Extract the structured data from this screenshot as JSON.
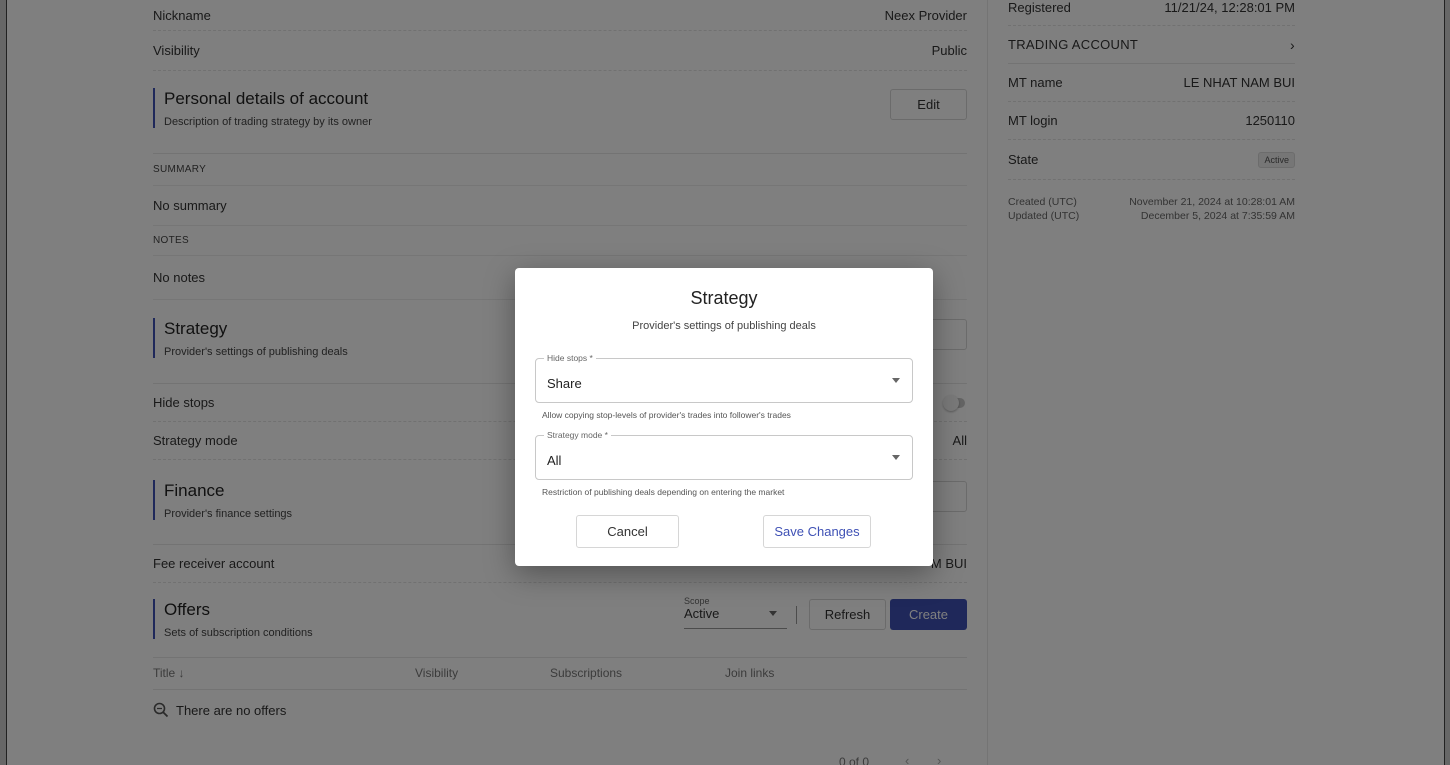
{
  "account": {
    "nickname_label": "Nickname",
    "nickname_value": "Neex Provider",
    "visibility_label": "Visibility",
    "visibility_value": "Public"
  },
  "personal": {
    "title": "Personal details of account",
    "subtitle": "Description of trading strategy by its owner",
    "edit_label": "Edit",
    "summary_caption": "SUMMARY",
    "summary_value": "No summary",
    "notes_caption": "NOTES",
    "notes_value": "No notes"
  },
  "strategy": {
    "title": "Strategy",
    "subtitle": "Provider's settings of publishing deals",
    "hide_stops_label": "Hide stops",
    "mode_label": "Strategy mode",
    "mode_value": "All"
  },
  "finance": {
    "title": "Finance",
    "subtitle": "Provider's finance settings",
    "fee_label": "Fee receiver account",
    "fee_value_partial": "M BUI"
  },
  "offers": {
    "title": "Offers",
    "subtitle": "Sets of subscription conditions",
    "scope_label": "Scope",
    "scope_value": "Active",
    "refresh_label": "Refresh",
    "create_label": "Create",
    "columns": [
      "Title ↓",
      "Visibility",
      "Subscriptions",
      "Join links"
    ],
    "empty_text": "There are no offers",
    "pagination": "0 of 0"
  },
  "side": {
    "registered_label": "Registered",
    "registered_value": "11/21/24, 12:28:01 PM",
    "trading_account_caption": "TRADING ACCOUNT",
    "mt_name_label": "MT name",
    "mt_name_value": "LE NHAT NAM BUI",
    "mt_login_label": "MT login",
    "mt_login_value": "1250110",
    "state_label": "State",
    "state_value": "Active",
    "created_label": "Created (UTC)",
    "created_value": "November 21, 2024 at 10:28:01 AM",
    "updated_label": "Updated (UTC)",
    "updated_value": "December 5, 2024 at 7:35:59 AM"
  },
  "dialog": {
    "title": "Strategy",
    "subtitle": "Provider's settings of publishing deals",
    "hide_stops_label": "Hide stops *",
    "hide_stops_value": "Share",
    "hide_stops_helper": "Allow copying stop-levels of provider's trades into follower's trades",
    "mode_label": "Strategy mode *",
    "mode_value": "All",
    "mode_helper": "Restriction of publishing deals depending on entering the market",
    "cancel_label": "Cancel",
    "save_label": "Save Changes"
  },
  "colors": {
    "accent": "#3f51b5",
    "overlay": "rgba(0,0,0,0.5)"
  }
}
